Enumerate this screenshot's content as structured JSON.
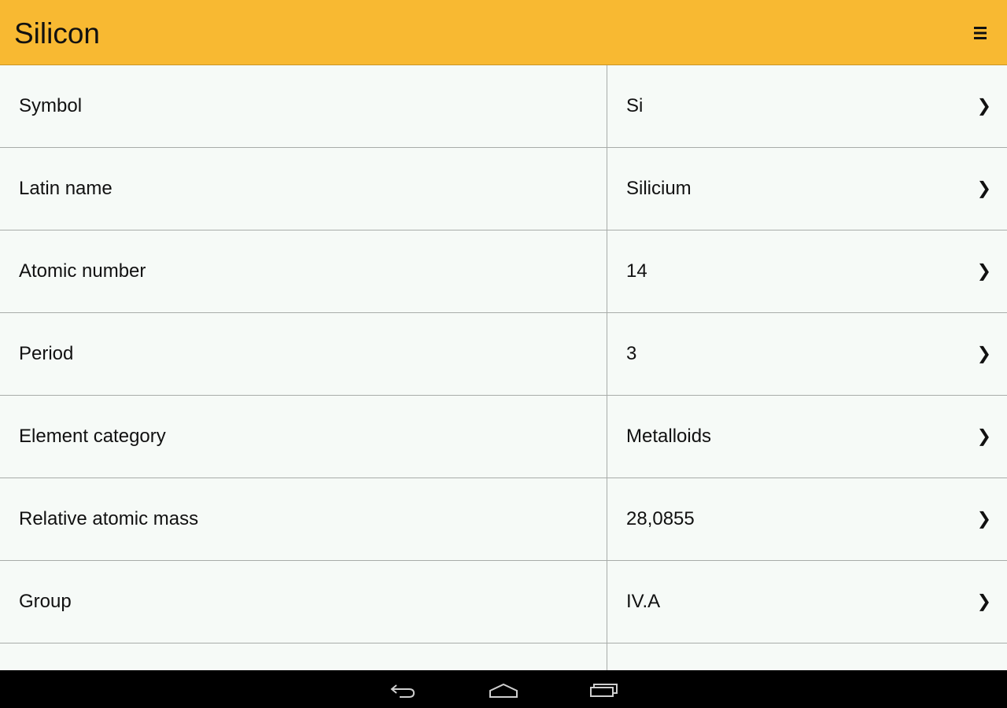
{
  "action_bar": {
    "title": "Silicon",
    "background": "#f8b932",
    "menu_icon": "overflow-menu-icon"
  },
  "properties": [
    {
      "label": "Symbol",
      "value": "Si"
    },
    {
      "label": "Latin name",
      "value": "Silicium"
    },
    {
      "label": "Atomic number",
      "value": "14"
    },
    {
      "label": "Period",
      "value": "3"
    },
    {
      "label": "Element category",
      "value": "Metalloids"
    },
    {
      "label": "Relative atomic mass",
      "value": "28,0855"
    },
    {
      "label": "Group",
      "value": "IV.A"
    }
  ],
  "row_chevron": "❯",
  "nav_bar": {
    "buttons": [
      "back-icon",
      "home-icon",
      "recent-apps-icon"
    ]
  }
}
